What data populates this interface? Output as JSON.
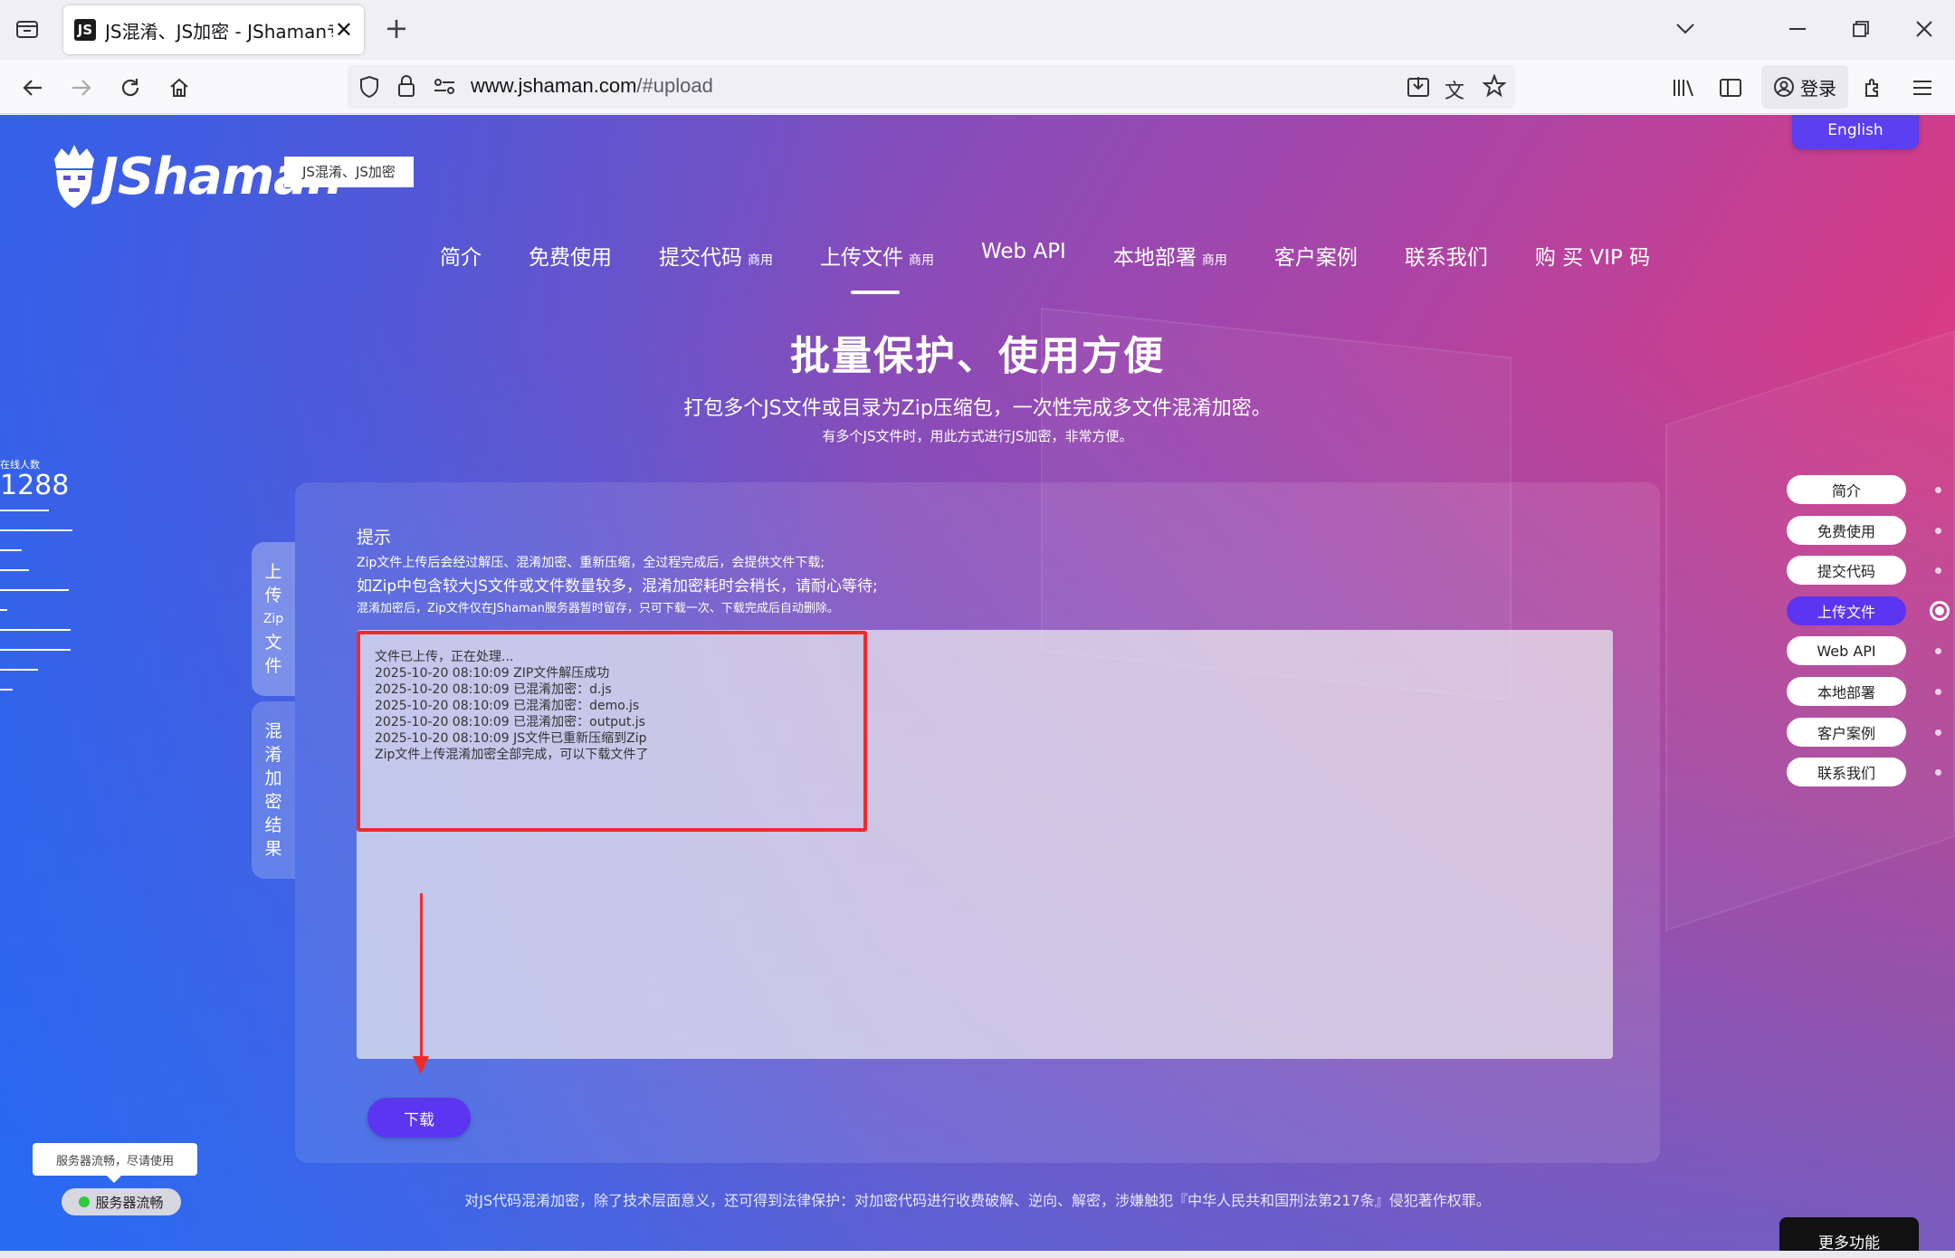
{
  "browser": {
    "tab_title": "JS混淆、JS加密 - JShaman专业",
    "tab_favicon": "JS",
    "url_host": "www.jshaman.com",
    "url_path": "/#upload",
    "login_label": "登录"
  },
  "site": {
    "logo_text": "JShaman",
    "logo_tag": "JS混淆、JS加密",
    "english_label": "English"
  },
  "nav": {
    "items": [
      {
        "label": "简介",
        "badge": ""
      },
      {
        "label": "免费使用",
        "badge": ""
      },
      {
        "label": "提交代码",
        "badge": "商用"
      },
      {
        "label": "上传文件",
        "badge": "商用"
      },
      {
        "label": "Web API",
        "badge": ""
      },
      {
        "label": "本地部署",
        "badge": "商用"
      },
      {
        "label": "客户案例",
        "badge": ""
      },
      {
        "label": "联系我们",
        "badge": ""
      },
      {
        "label": "购 买 VIP 码",
        "badge": ""
      }
    ],
    "active_index": 3
  },
  "hero": {
    "title": "批量保护、使用方便",
    "subtitle": "打包多个JS文件或目录为Zip压缩包，一次性完成多文件混淆加密。",
    "subtitle2": "有多个JS文件时，用此方式进行JS加密，非常方便。"
  },
  "online": {
    "label": "在线人数",
    "count": "1288"
  },
  "side_tabs": {
    "upload": {
      "line1": "上",
      "line2": "传",
      "zip": "Zip",
      "line3": "文",
      "line4": "件"
    },
    "result": [
      "混",
      "淆",
      "加",
      "密",
      "结",
      "果"
    ]
  },
  "tips": {
    "title": "提示",
    "line1": "Zip文件上传后会经过解压、混淆加密、重新压缩，全过程完成后，会提供文件下载;",
    "line2": "如Zip中包含较大JS文件或文件数量较多，混淆加密耗时会稍长，请耐心等待;",
    "line3": "混淆加密后，Zip文件仅在JShaman服务器暂时留存，只可下载一次、下载完成后自动删除。"
  },
  "log": {
    "lines": [
      "文件已上传，正在处理...",
      "2025-10-20 08:10:09 ZIP文件解压成功",
      "2025-10-20 08:10:09 已混淆加密：d.js",
      "2025-10-20 08:10:09 已混淆加密：demo.js",
      "2025-10-20 08:10:09 已混淆加密：output.js",
      "2025-10-20 08:10:09 JS文件已重新压缩到Zip",
      "Zip文件上传混淆加密全部完成，可以下载文件了"
    ]
  },
  "download_label": "下载",
  "quick_nav": {
    "items": [
      "简介",
      "免费使用",
      "提交代码",
      "上传文件",
      "Web API",
      "本地部署",
      "客户案例",
      "联系我们"
    ],
    "active_index": 3
  },
  "server": {
    "tooltip": "服务器流畅，尽请使用",
    "status": "服务器流畅"
  },
  "footer_notice": "对JS代码混淆加密，除了技术层面意义，还可得到法律保护：对加密代码进行收费破解、逆向、解密，涉嫌触犯『中华人民共和国刑法第217条』侵犯著作权罪。",
  "more_label": "更多功能",
  "colors": {
    "accent": "#5b35f0",
    "highlight_red": "#ee2b2b",
    "status_green": "#2ccb3d"
  }
}
